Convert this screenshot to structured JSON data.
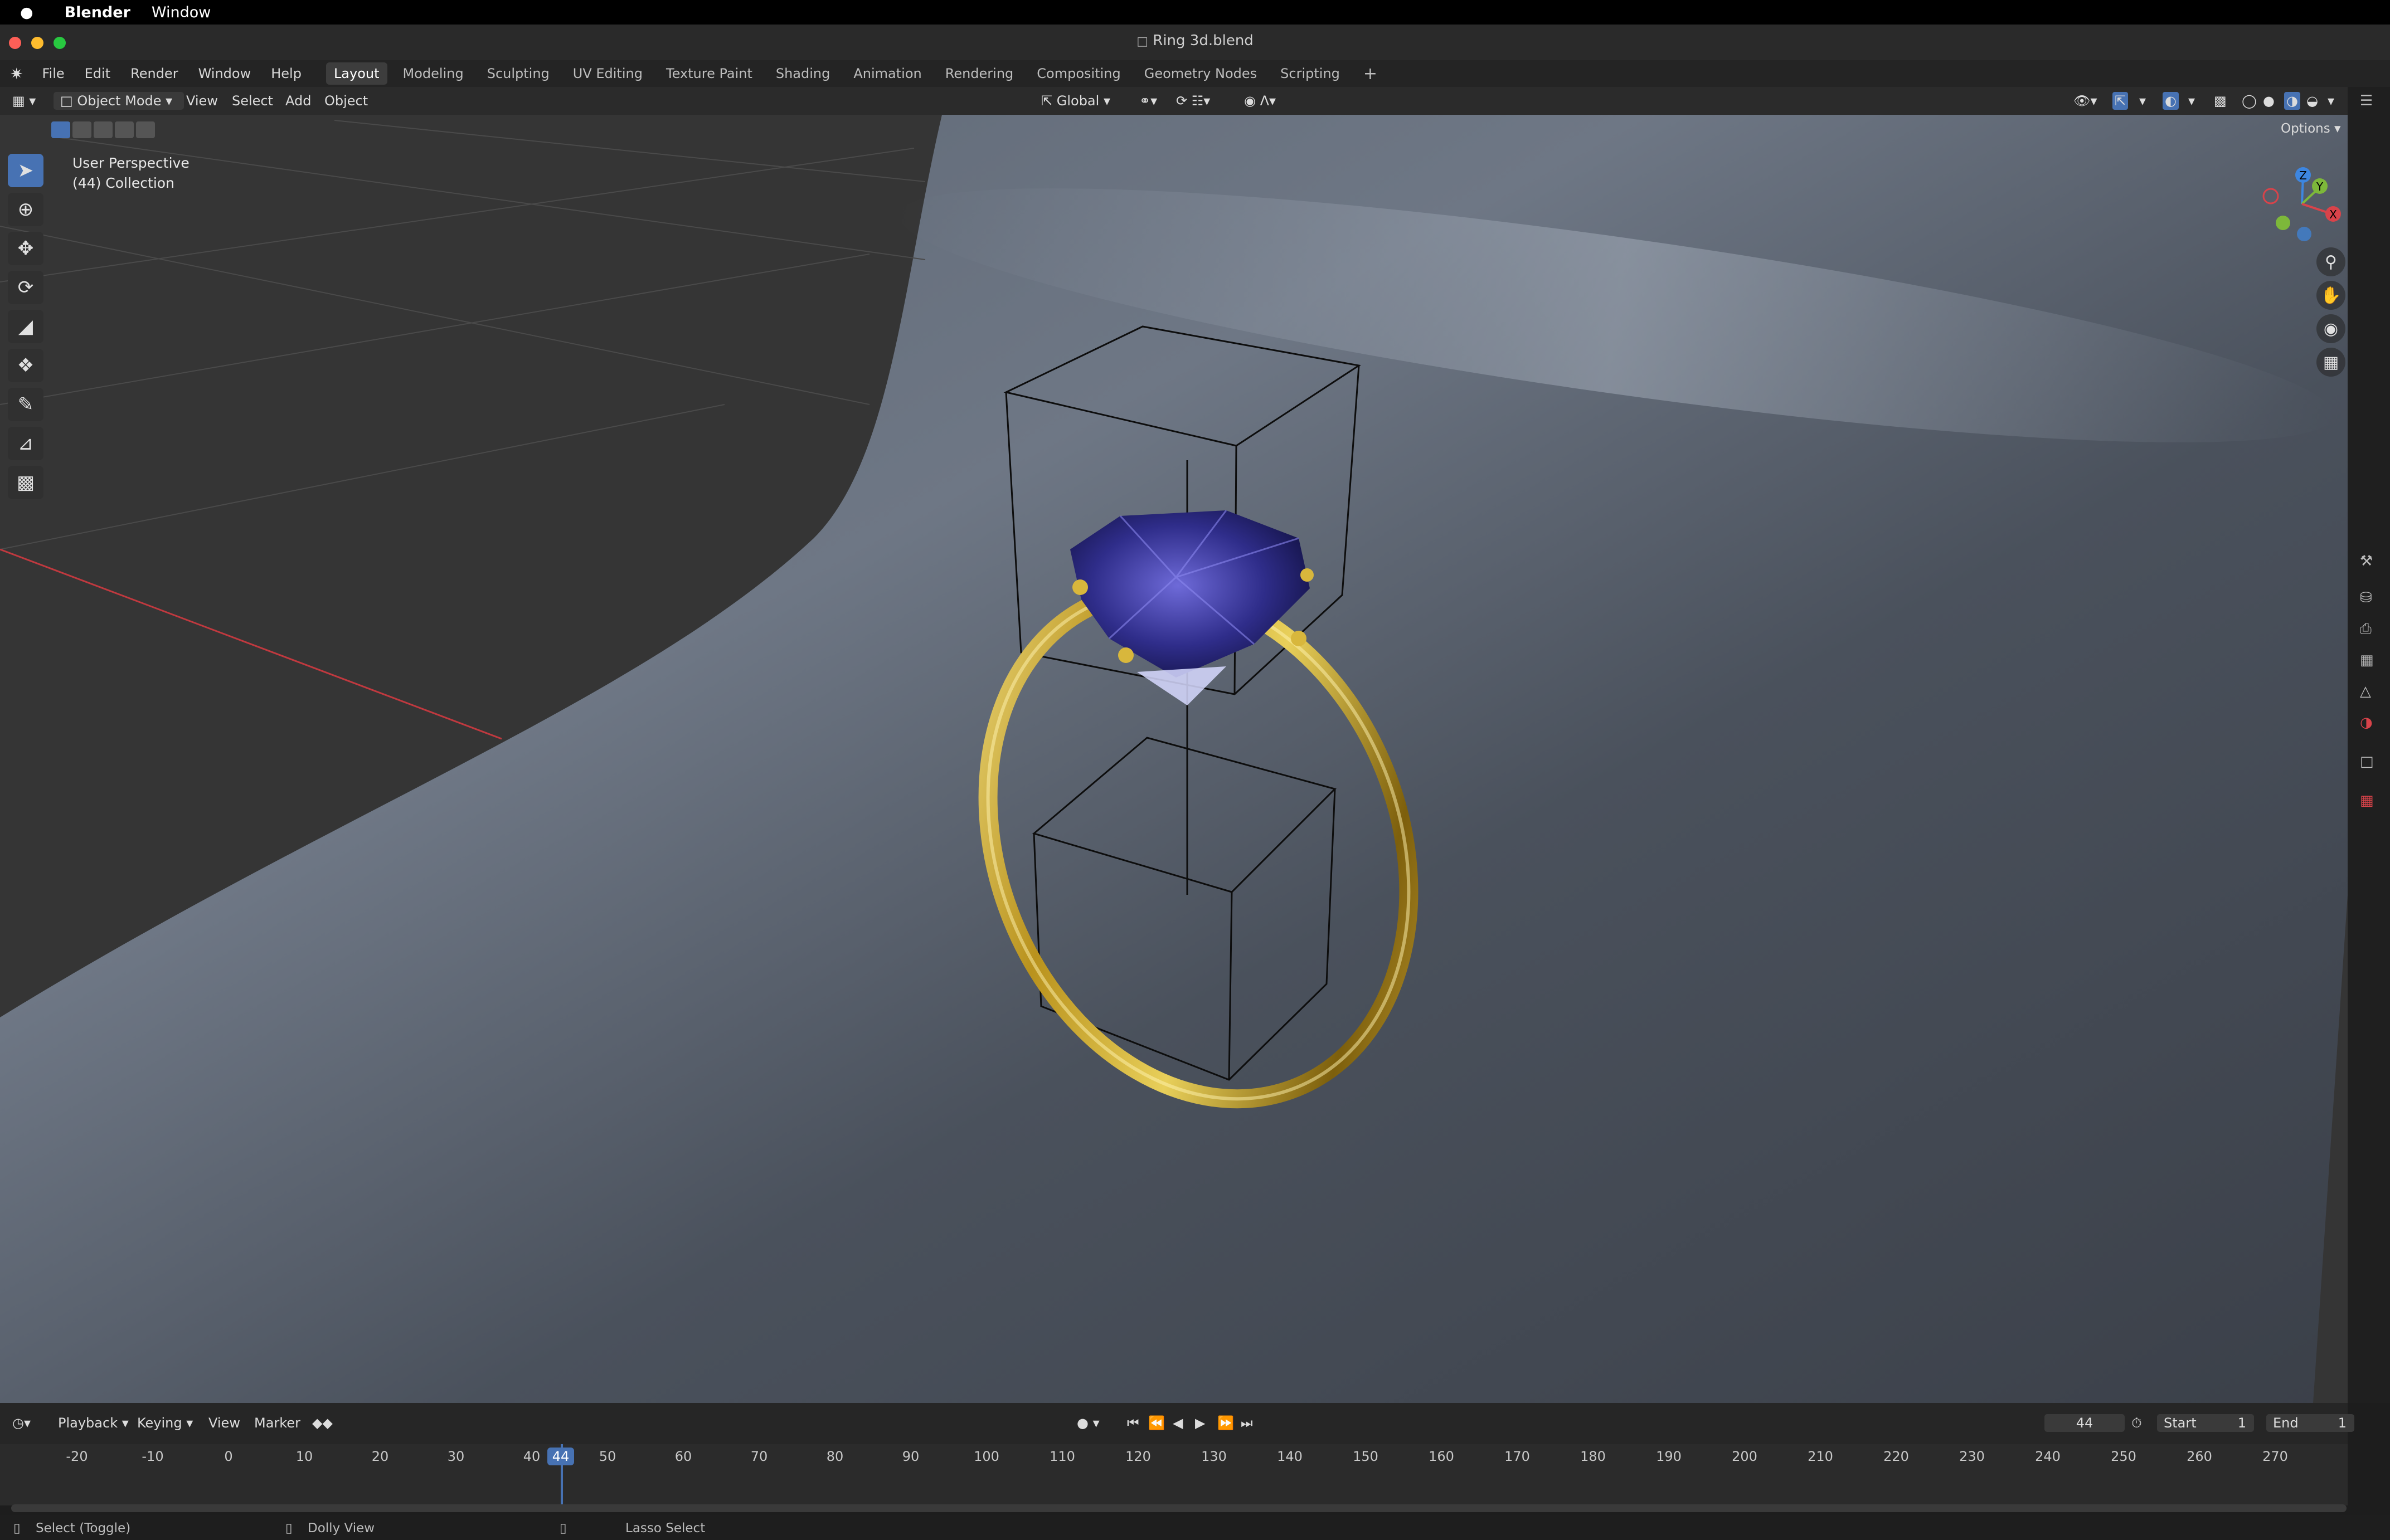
{
  "menubar": {
    "apple_icon": "apple-icon",
    "app": "Blender",
    "window": "Window"
  },
  "window": {
    "title": "Ring 3d.blend",
    "file_icon": "document-icon"
  },
  "topbar": {
    "menus": [
      "File",
      "Edit",
      "Render",
      "Window",
      "Help"
    ],
    "workspaces": [
      "Layout",
      "Modeling",
      "Sculpting",
      "UV Editing",
      "Texture Paint",
      "Shading",
      "Animation",
      "Rendering",
      "Compositing",
      "Geometry Nodes",
      "Scripting"
    ],
    "active_workspace": "Layout",
    "add_workspace": "+"
  },
  "viewport_header": {
    "mode": "Object Mode",
    "menus": [
      "View",
      "Select",
      "Add",
      "Object"
    ],
    "orientation": "Global",
    "options": "Options"
  },
  "viewport": {
    "perspective": "User Perspective",
    "collection": "(44) Collection",
    "gizmo_axes": [
      "Z",
      "Y",
      "X"
    ]
  },
  "timeline": {
    "menus": [
      "Playback",
      "Keying",
      "View",
      "Marker"
    ],
    "current_frame": "44",
    "start_label": "Start",
    "start": "1",
    "end_label": "End",
    "end": "1",
    "ticks": [
      "-20",
      "-10",
      "0",
      "10",
      "20",
      "30",
      "40",
      "50",
      "60",
      "70",
      "80",
      "90",
      "100",
      "110",
      "120",
      "130",
      "140",
      "150",
      "160",
      "170",
      "180",
      "190",
      "200",
      "210",
      "220",
      "230",
      "240",
      "250",
      "260",
      "270"
    ],
    "playhead": "44"
  },
  "statusbar": {
    "select": "Select (Toggle)",
    "dolly": "Dolly View",
    "lasso": "Lasso Select"
  },
  "colors": {
    "accent": "#4772b3",
    "gold": "#c9a227",
    "gem": "#3b3aa0",
    "x_axis": "#d9434a",
    "y_axis": "#7db83a",
    "z_axis": "#3d86e0"
  }
}
